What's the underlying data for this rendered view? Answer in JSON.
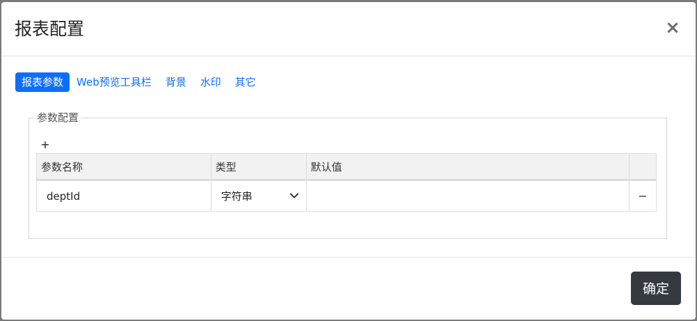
{
  "modal": {
    "title": "报表配置",
    "close_symbol": "×"
  },
  "tabs": [
    {
      "label": "报表参数",
      "active": true
    },
    {
      "label": "Web预览工具栏",
      "active": false
    },
    {
      "label": "背景",
      "active": false
    },
    {
      "label": "水印",
      "active": false
    },
    {
      "label": "其它",
      "active": false
    }
  ],
  "params_section": {
    "legend": "参数配置",
    "add_symbol": "+",
    "columns": [
      "参数名称",
      "类型",
      "默认值",
      ""
    ],
    "rows": [
      {
        "name": "deptId",
        "type": "字符串",
        "default": "",
        "remove_symbol": "−"
      }
    ]
  },
  "footer": {
    "confirm_label": "确定"
  },
  "icons": {
    "close": "close-icon",
    "add": "plus-icon",
    "remove": "minus-icon",
    "select": "chevron-down-icon"
  },
  "colors": {
    "accent": "#0d6efd",
    "confirm_bg": "#343a40"
  }
}
